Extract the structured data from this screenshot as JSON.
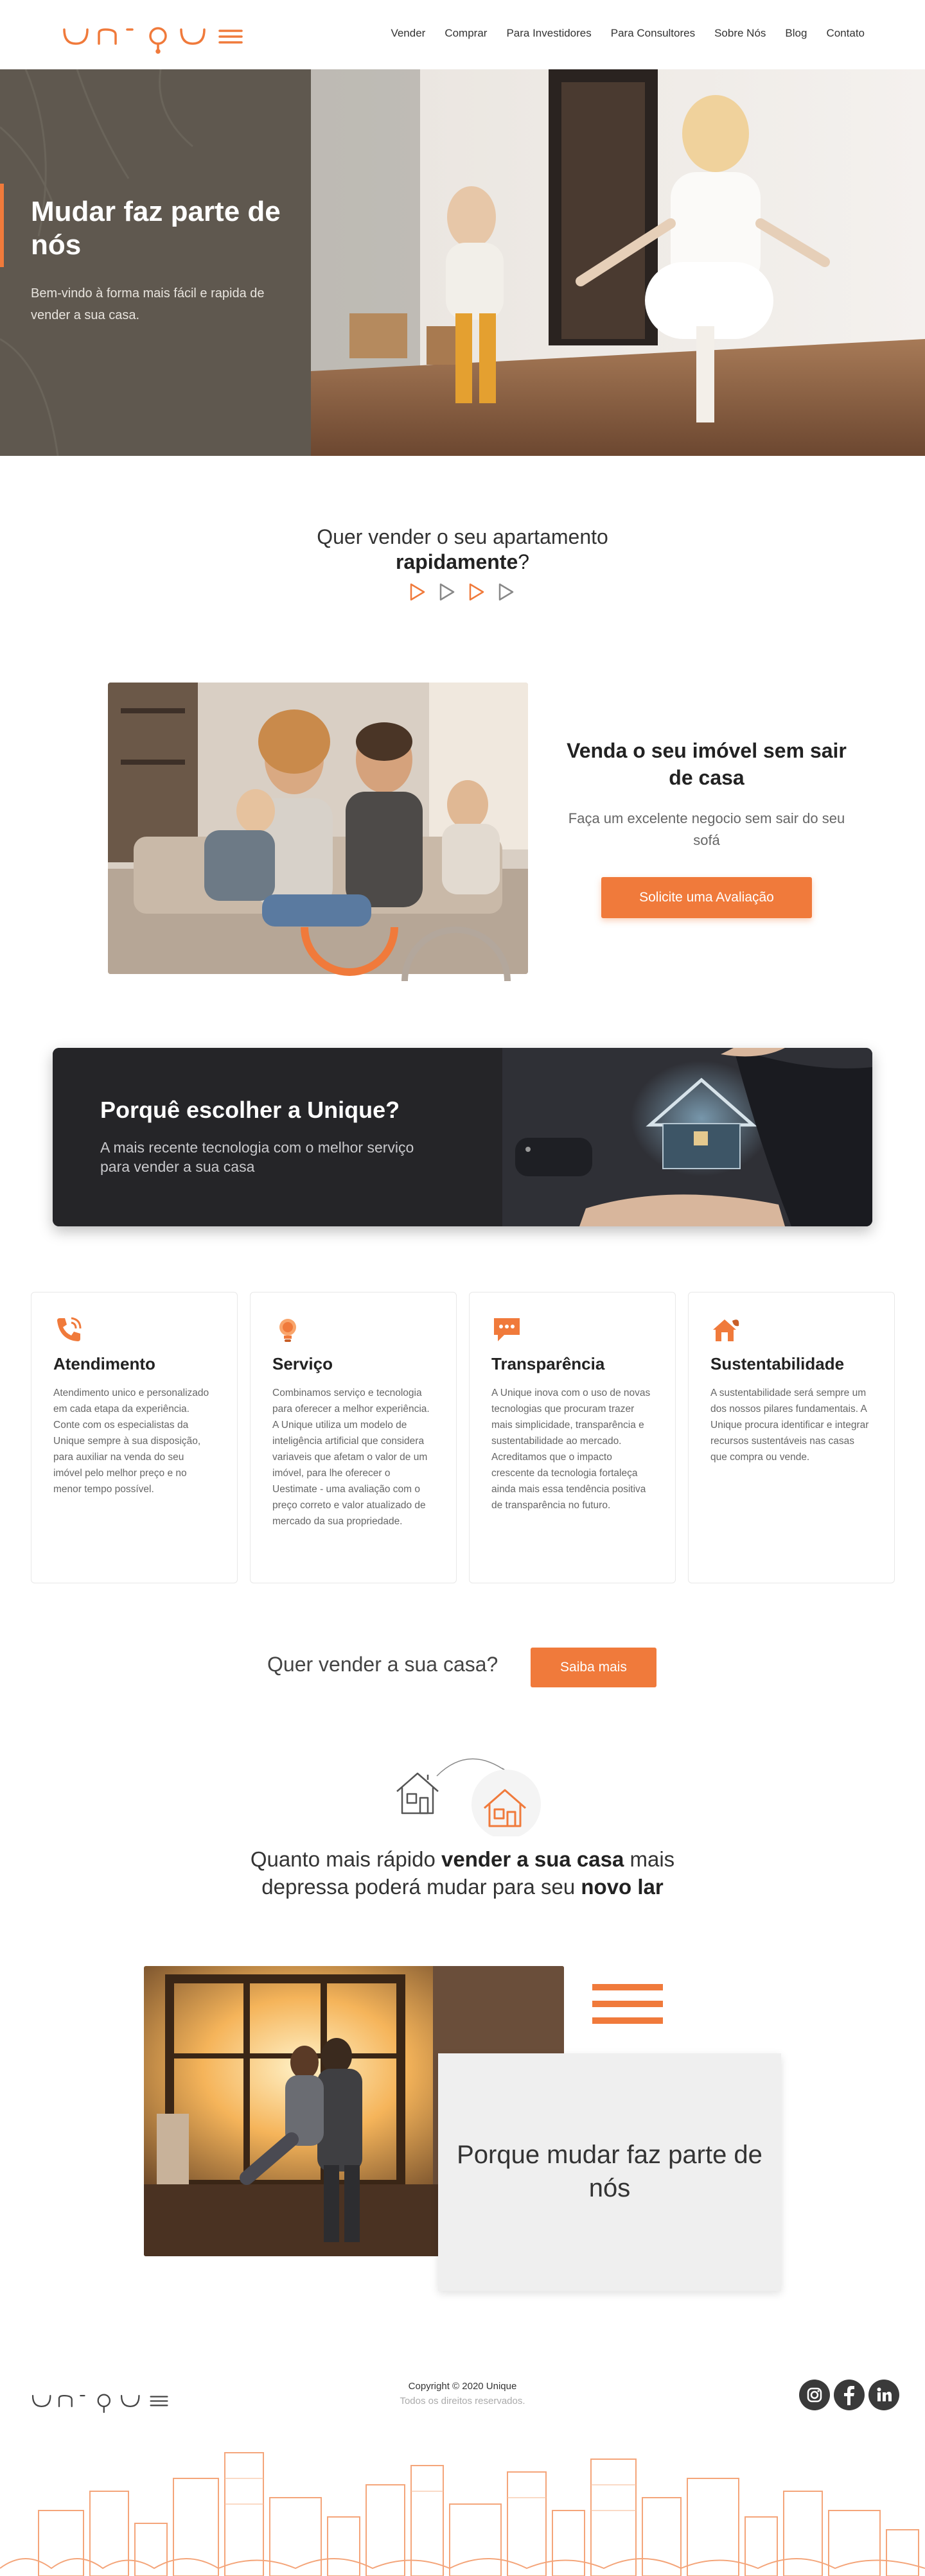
{
  "brand": {
    "accent": "#f07a3b",
    "dark": "#252528"
  },
  "nav": {
    "items": [
      "Vender",
      "Comprar",
      "Para Investidores",
      "Para Consultores",
      "Sobre Nós",
      "Blog",
      "Contato"
    ]
  },
  "hero": {
    "title": "Mudar faz parte de nós",
    "subtitle": "Bem-vindo à forma mais fácil e rapida de vender a sua casa."
  },
  "quer_vender": {
    "line1": "Quer vender o seu apartamento",
    "line2_bold": "rapidamente",
    "line2_tail": "?"
  },
  "sell": {
    "title": "Venda o seu imóvel sem sair de casa",
    "text": "Faça um excelente negocio sem sair do seu sofá",
    "button": "Solicite uma Avaliação"
  },
  "banner": {
    "title": "Porquê escolher a Unique?",
    "subtitle": "A mais recente tecnologia com o melhor serviço para vender a sua casa"
  },
  "cards": [
    {
      "icon": "phone-icon",
      "title": "Atendimento",
      "text": "Atendimento unico e personalizado em cada etapa da experiência. Conte com os especialistas da Unique sempre à sua disposição, para auxiliar na venda do seu imóvel pelo melhor preço e no menor tempo possível."
    },
    {
      "icon": "lightbulb-icon",
      "title": "Serviço",
      "text": "Combinamos serviço e tecnologia para oferecer a melhor experiência. A Unique utiliza um modelo de inteligência artificial que considera variaveis que afetam o valor de um imóvel, para lhe oferecer o Uestimate - uma avaliação com o preço correto e valor atualizado de mercado da sua propriedade."
    },
    {
      "icon": "chat-icon",
      "title": "Transparência",
      "text": "A Unique inova com o uso de novas tecnologias que procuram trazer mais simplicidade, transparência e sustentabilidade ao mercado. Acreditamos que o impacto crescente da tecnologia fortaleça ainda mais essa tendência positiva de transparência no futuro."
    },
    {
      "icon": "eco-house-icon",
      "title": "Sustentabilidade",
      "text": "A sustentabilidade será sempre um dos nossos pilares fundamentais. A Unique procura identificar e integrar recursos sustentáveis nas casas que compra ou vende."
    }
  ],
  "cta": {
    "text": "Quer vender a sua casa?",
    "button": "Saiba mais"
  },
  "faster": {
    "p1": "Quanto mais rápido ",
    "b1": "vender a sua casa",
    "p2": " mais",
    "p3": "depressa poderá mudar para seu ",
    "b2": "novo lar"
  },
  "last": {
    "box_text": "Porque mudar faz parte de nós"
  },
  "footer": {
    "copyright": "Copyright © 2020 Unique",
    "rights": "Todos os direitos reservados.",
    "social": [
      "instagram-icon",
      "facebook-icon",
      "linkedin-icon"
    ]
  }
}
